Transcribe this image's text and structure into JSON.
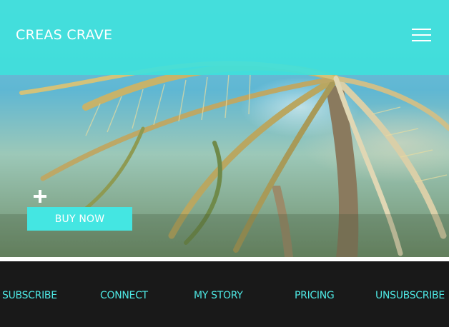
{
  "header": {
    "brand": "CREAS CRAVE",
    "menu_icon": "hamburger-menu-icon",
    "background_color": "#40E0DC"
  },
  "hero": {
    "image_icon": "palm-tree-photo",
    "plus_icon": "plus-icon",
    "cta_label": "BUY NOW",
    "accent_color": "#44E6E2"
  },
  "footer": {
    "background_color": "#191919",
    "link_color": "#4EE8E4",
    "links": [
      "SUBSCRIBE",
      "CONNECT",
      "MY STORY",
      "PRICING",
      "UNSUBSCRIBE"
    ]
  }
}
